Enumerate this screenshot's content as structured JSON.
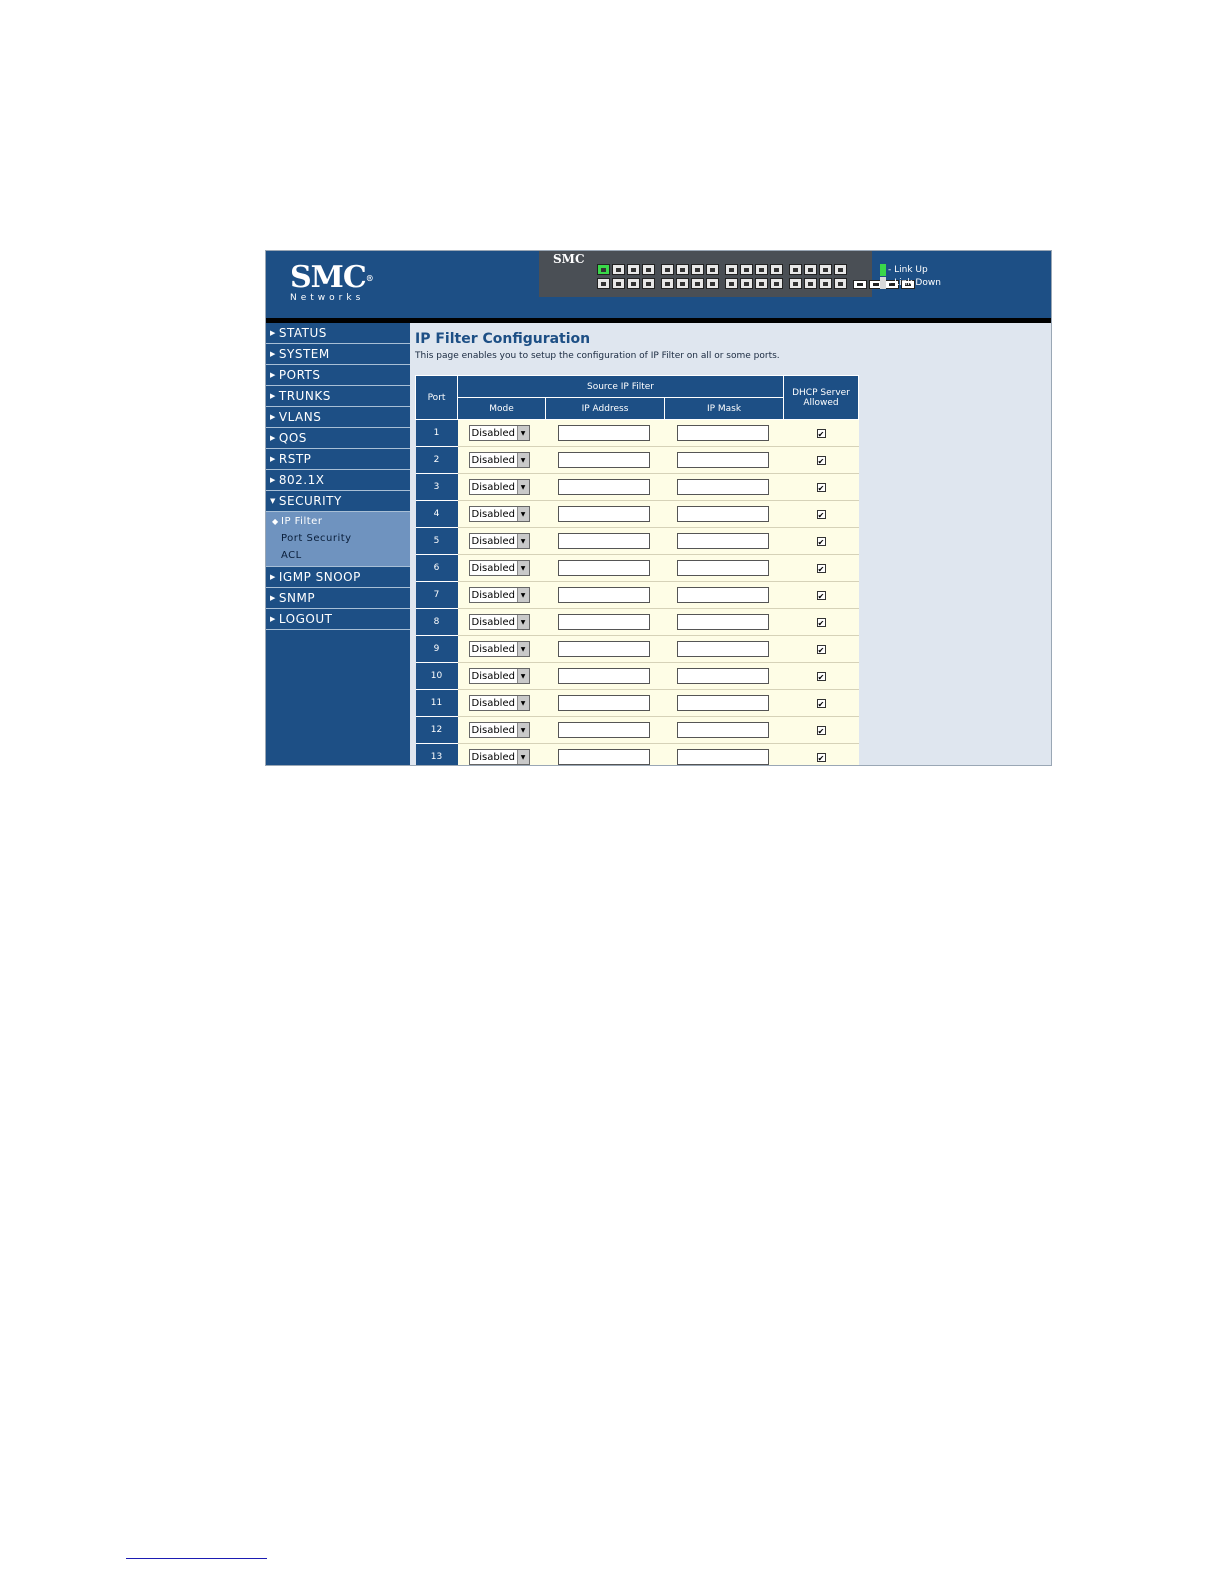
{
  "header": {
    "logo_brand": "SMC",
    "logo_sub": "Networks",
    "switch_label": "SMC",
    "legend": [
      {
        "label": "- Link Up",
        "color": "#3ad84a"
      },
      {
        "label": "- Link Down",
        "color": "#d8d8d8"
      }
    ]
  },
  "sidebar": {
    "items": [
      {
        "label": "STATUS"
      },
      {
        "label": "SYSTEM"
      },
      {
        "label": "PORTS"
      },
      {
        "label": "TRUNKS"
      },
      {
        "label": "VLANS"
      },
      {
        "label": "QOS"
      },
      {
        "label": "RSTP"
      },
      {
        "label": "802.1X"
      },
      {
        "label": "SECURITY"
      },
      {
        "label": "IGMP SNOOP"
      },
      {
        "label": "SNMP"
      },
      {
        "label": "LOGOUT"
      }
    ],
    "security_sub": [
      {
        "label": "IP Filter"
      },
      {
        "label": "Port Security"
      },
      {
        "label": "ACL"
      }
    ]
  },
  "main": {
    "title": "IP Filter Configuration",
    "description": "This page enables you to setup the configuration of IP Filter on all or some ports.",
    "table": {
      "col_port": "Port",
      "col_source": "Source IP Filter",
      "col_mode": "Mode",
      "col_ip": "IP Address",
      "col_mask": "IP Mask",
      "col_dhcp": "DHCP Server Allowed",
      "rows": [
        {
          "port": "1",
          "mode": "Disabled",
          "ip": "",
          "mask": "",
          "dhcp": true
        },
        {
          "port": "2",
          "mode": "Disabled",
          "ip": "",
          "mask": "",
          "dhcp": true
        },
        {
          "port": "3",
          "mode": "Disabled",
          "ip": "",
          "mask": "",
          "dhcp": true
        },
        {
          "port": "4",
          "mode": "Disabled",
          "ip": "",
          "mask": "",
          "dhcp": true
        },
        {
          "port": "5",
          "mode": "Disabled",
          "ip": "",
          "mask": "",
          "dhcp": true
        },
        {
          "port": "6",
          "mode": "Disabled",
          "ip": "",
          "mask": "",
          "dhcp": true
        },
        {
          "port": "7",
          "mode": "Disabled",
          "ip": "",
          "mask": "",
          "dhcp": true
        },
        {
          "port": "8",
          "mode": "Disabled",
          "ip": "",
          "mask": "",
          "dhcp": true
        },
        {
          "port": "9",
          "mode": "Disabled",
          "ip": "",
          "mask": "",
          "dhcp": true
        },
        {
          "port": "10",
          "mode": "Disabled",
          "ip": "",
          "mask": "",
          "dhcp": true
        },
        {
          "port": "11",
          "mode": "Disabled",
          "ip": "",
          "mask": "",
          "dhcp": true
        },
        {
          "port": "12",
          "mode": "Disabled",
          "ip": "",
          "mask": "",
          "dhcp": true
        },
        {
          "port": "13",
          "mode": "Disabled",
          "ip": "",
          "mask": "",
          "dhcp": true
        }
      ]
    }
  }
}
